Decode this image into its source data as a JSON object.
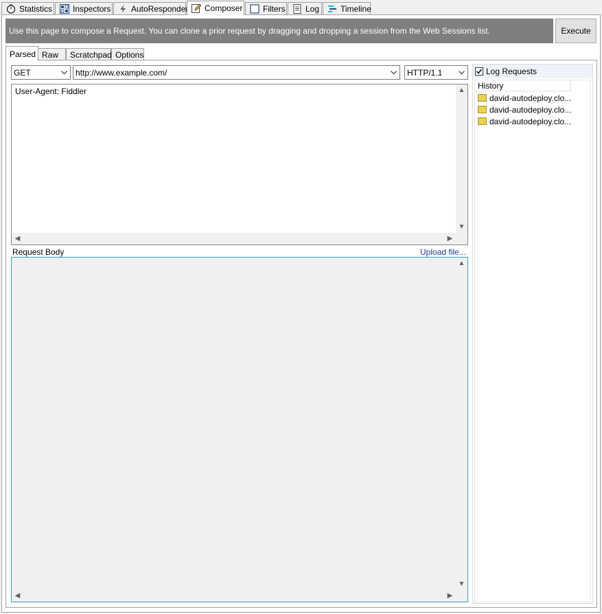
{
  "tabs": [
    {
      "label": "Statistics",
      "icon": "stopwatch-icon"
    },
    {
      "label": "Inspectors",
      "icon": "inspect-icon"
    },
    {
      "label": "AutoResponder",
      "icon": "lightning-icon"
    },
    {
      "label": "Composer",
      "icon": "pencil-icon",
      "active": true
    },
    {
      "label": "Filters",
      "icon": "checkbox-icon"
    },
    {
      "label": "Log",
      "icon": "document-icon"
    },
    {
      "label": "Timeline",
      "icon": "timeline-icon"
    }
  ],
  "info": {
    "text": "Use this page to compose a Request. You can clone a prior request by dragging and dropping a session from the Web Sessions list.",
    "execute_label": "Execute"
  },
  "subtabs": [
    {
      "label": "Parsed",
      "active": true
    },
    {
      "label": "Raw"
    },
    {
      "label": "Scratchpad"
    },
    {
      "label": "Options"
    }
  ],
  "request": {
    "method": "GET",
    "url": "http://www.example.com/",
    "version": "HTTP/1.1",
    "headers": "User-Agent: Fiddler",
    "body_label": "Request Body",
    "upload_label": "Upload file..."
  },
  "history": {
    "log_label": "Log Requests",
    "log_checked": true,
    "header": "History",
    "items": [
      "david-autodeploy.clo...",
      "david-autodeploy.clo...",
      "david-autodeploy.clo..."
    ]
  },
  "colors": {
    "info_bar": "#7f7f7f",
    "link": "#1a3c9a",
    "session_icon": "#e9d24f"
  }
}
